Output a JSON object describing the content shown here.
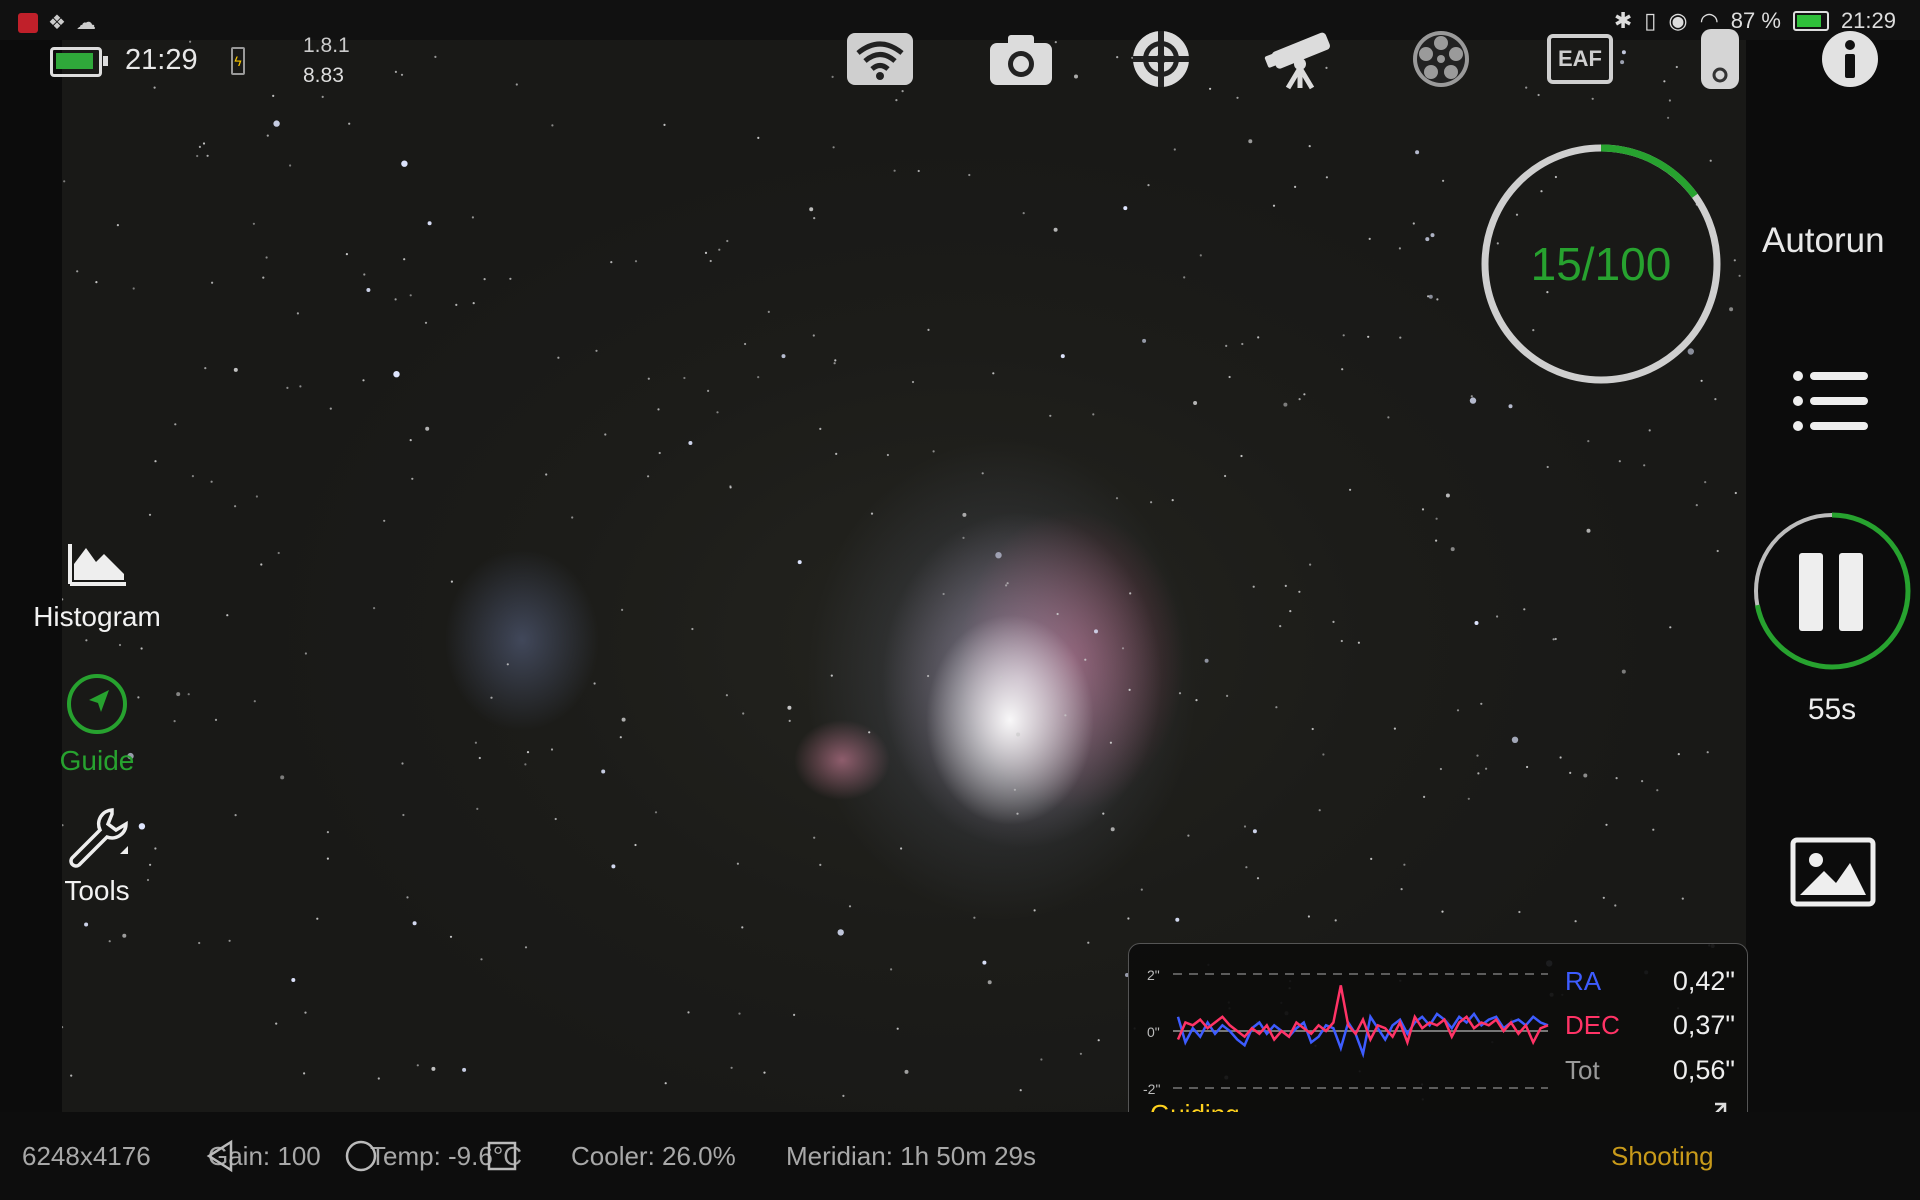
{
  "status_bar": {
    "battery_percent": "87 %",
    "time": "21:29"
  },
  "device": {
    "time": "21:29",
    "version": "1.8.1",
    "voltage": "8.83"
  },
  "toolbar": {
    "icons": [
      "wifi-icon",
      "camera-icon",
      "guide-scope-icon",
      "telescope-icon",
      "filter-wheel-icon",
      "eaf-icon",
      "usb-drive-icon",
      "info-icon"
    ],
    "eaf_label": "EAF"
  },
  "left_menu": {
    "histogram": "Histogram",
    "guide": "Guide",
    "tools": "Tools"
  },
  "autorun": {
    "progress_text": "15/100",
    "current": 15,
    "total": 100,
    "label": "Autorun",
    "exposure_remaining": "55s",
    "exposure_progress": 0.72
  },
  "guiding": {
    "title": "Guiding",
    "y_labels": [
      "2\"",
      "0\"",
      "-2\""
    ],
    "ra_label": "RA",
    "ra_value": "0,42\"",
    "dec_label": "DEC",
    "dec_value": "0,37\"",
    "tot_label": "Tot",
    "tot_value": "0,56\"",
    "ra_color": "#3d5cff",
    "dec_color": "#ff3366",
    "ra_trace": [
      0.5,
      -0.4,
      0.1,
      -0.2,
      0.3,
      -0.1,
      0.2,
      0.0,
      -0.3,
      -0.5,
      0.1,
      0.3,
      -0.1,
      0.2,
      0.0,
      -0.2,
      0.1,
      0.3,
      -0.4,
      -0.2,
      0.2,
      0.1,
      -0.6,
      0.3,
      -0.1,
      -0.8,
      0.5,
      0.1,
      -0.3,
      0.2,
      0.4,
      -0.1,
      0.3,
      0.5,
      0.2,
      0.6,
      0.4,
      0.1,
      0.5,
      0.3,
      0.6,
      0.2,
      0.4,
      0.5,
      0.1,
      0.3,
      0.4,
      0.2,
      0.5,
      0.3,
      0.2
    ],
    "dec_trace": [
      -0.3,
      0.3,
      0.2,
      0.4,
      0.1,
      0.3,
      0.5,
      0.2,
      0.0,
      -0.2,
      0.1,
      -0.1,
      0.2,
      -0.3,
      0.0,
      -0.2,
      0.3,
      0.1,
      -0.1,
      0.2,
      0.0,
      0.3,
      1.6,
      0.2,
      -0.1,
      0.4,
      -0.3,
      0.2,
      0.1,
      -0.2,
      0.3,
      -0.4,
      0.5,
      0.1,
      0.3,
      0.2,
      0.4,
      -0.2,
      0.3,
      0.5,
      0.1,
      0.3,
      0.2,
      0.4,
      0.0,
      0.3,
      -0.1,
      0.2,
      -0.4,
      0.1,
      0.2
    ],
    "accent_color": "#ffd21e"
  },
  "bottom_bar": {
    "resolution": "6248x4176",
    "gain": "Gain: 100",
    "temp": "Temp: -9.6°C",
    "cooler": "Cooler: 26.0%",
    "meridian": "Meridian: 1h 50m 29s",
    "mode": "Shooting"
  },
  "colors": {
    "accent_green": "#27a22f",
    "mode_color": "#c89a1a"
  }
}
